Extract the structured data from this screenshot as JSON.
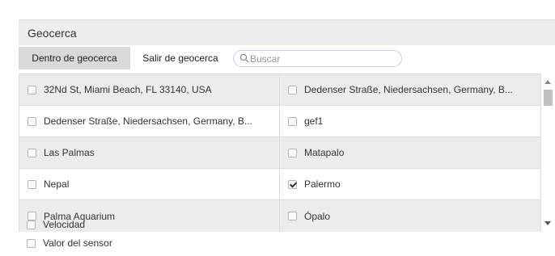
{
  "panel": {
    "title": "Geocerca"
  },
  "tabs": [
    {
      "label": "Dentro de geocerca",
      "active": true
    },
    {
      "label": "Salir de geocerca",
      "active": false
    }
  ],
  "search": {
    "placeholder": "Buscar",
    "value": "",
    "icon": "search-icon"
  },
  "geofences": [
    {
      "label": "32Nd St, Miami Beach, FL 33140, USA",
      "checked": false
    },
    {
      "label": "Dedenser Straße, Niedersachsen, Germany, B...",
      "checked": false
    },
    {
      "label": "Dedenser Straße, Niedersachsen, Germany, B...",
      "checked": false
    },
    {
      "label": "gef1",
      "checked": false
    },
    {
      "label": "Las Palmas",
      "checked": false
    },
    {
      "label": "Matapalo",
      "checked": false
    },
    {
      "label": "Nepal",
      "checked": false
    },
    {
      "label": "Palermo",
      "checked": true
    },
    {
      "label": "Palma Aquarium",
      "checked": false
    },
    {
      "label": "Ópalo",
      "checked": false
    }
  ],
  "options": [
    {
      "label": "Velocidad",
      "checked": false
    },
    {
      "label": "Valor del sensor",
      "checked": false
    }
  ],
  "colors": {
    "header_bg": "#eeeeee",
    "active_tab_bg": "#d9d9d9",
    "row_shade": "#ececec",
    "border": "#dddddd"
  }
}
